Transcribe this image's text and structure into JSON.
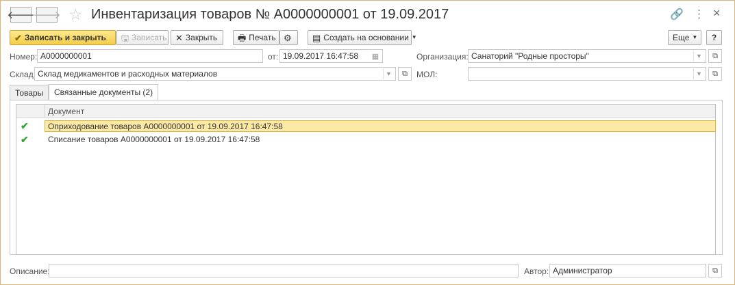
{
  "window": {
    "title": "Инвентаризация товаров № А0000000001 от 19.09.2017",
    "back_glyph": "🡐",
    "forward_glyph": "🡒",
    "link_glyph": "🔗",
    "more_glyph": "⋮",
    "close_glyph": "×"
  },
  "toolbar": {
    "save_close_label": "Записать и закрыть",
    "save_label": "Записать",
    "close_label": "Закрыть",
    "print_label": "Печать",
    "create_based_label": "Создать на основании",
    "more_label": "Еще",
    "help_label": "?"
  },
  "fields": {
    "number_label": "Номер:",
    "number_value": "А0000000001",
    "date_label": "от:",
    "date_value": "19.09.2017 16:47:58",
    "organization_label": "Организация:",
    "organization_value": "Санаторий \"Родные просторы\"",
    "warehouse_label": "Склад:",
    "warehouse_value": "Склад медикаментов и расходных материалов",
    "mol_label": "МОЛ:",
    "mol_value": "",
    "description_label": "Описание:",
    "description_value": "",
    "author_label": "Автор:",
    "author_value": "Администратор"
  },
  "tabs": [
    {
      "label": "Товары",
      "active": false
    },
    {
      "label": "Связанные документы (2)",
      "active": true
    }
  ],
  "table": {
    "columns": [
      "Документ"
    ],
    "rows": [
      {
        "checked": true,
        "document": "Оприходование товаров А0000000001 от 19.09.2017 16:47:58",
        "selected": true
      },
      {
        "checked": true,
        "document": "Списание товаров А0000000001 от 19.09.2017 16:47:58",
        "selected": false
      }
    ]
  },
  "colors": {
    "accent_button": "#f4ce47",
    "selection": "#fbe9a5",
    "check": "#33a532"
  }
}
